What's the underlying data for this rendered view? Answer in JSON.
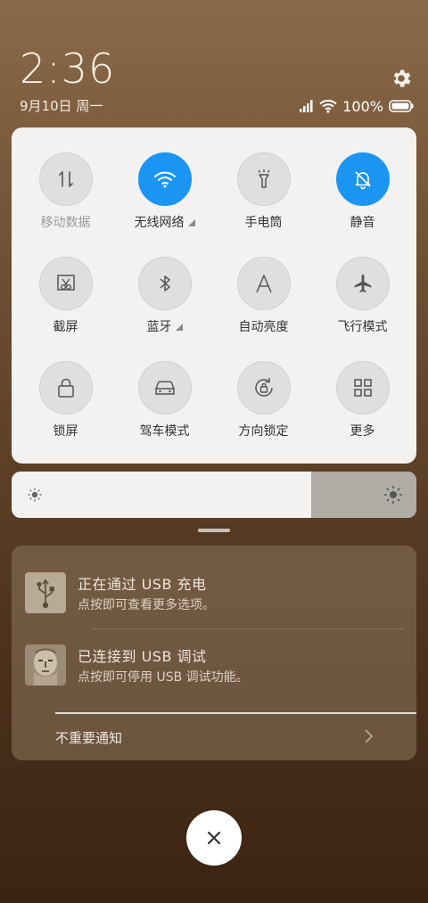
{
  "status_bar": {
    "time": "2:36",
    "date": "9月10日 周一",
    "battery": "100%"
  },
  "quick_settings": {
    "tiles": [
      {
        "label": "移动数据",
        "state": "disabled"
      },
      {
        "label": "无线网络",
        "state": "on"
      },
      {
        "label": "手电筒",
        "state": "off"
      },
      {
        "label": "静音",
        "state": "on"
      },
      {
        "label": "截屏",
        "state": "off"
      },
      {
        "label": "蓝牙",
        "state": "off"
      },
      {
        "label": "自动亮度",
        "state": "off"
      },
      {
        "label": "飞行模式",
        "state": "off"
      },
      {
        "label": "锁屏",
        "state": "off"
      },
      {
        "label": "驾车模式",
        "state": "off"
      },
      {
        "label": "方向锁定",
        "state": "off"
      },
      {
        "label": "更多",
        "state": "off"
      }
    ]
  },
  "brightness": {
    "level": 0.74
  },
  "notifications": [
    {
      "title": "正在通过 USB 充电",
      "subtitle": "点按即可查看更多选项。",
      "icon": "usb-icon"
    },
    {
      "title": "已连接到 USB 调试",
      "subtitle": "点按即可停用 USB 调试功能。",
      "icon": "debug-portrait-icon"
    }
  ],
  "minor_notifications_label": "不重要通知",
  "colors": {
    "accent": "#1a95f2",
    "panel": "#f3f2f1"
  }
}
